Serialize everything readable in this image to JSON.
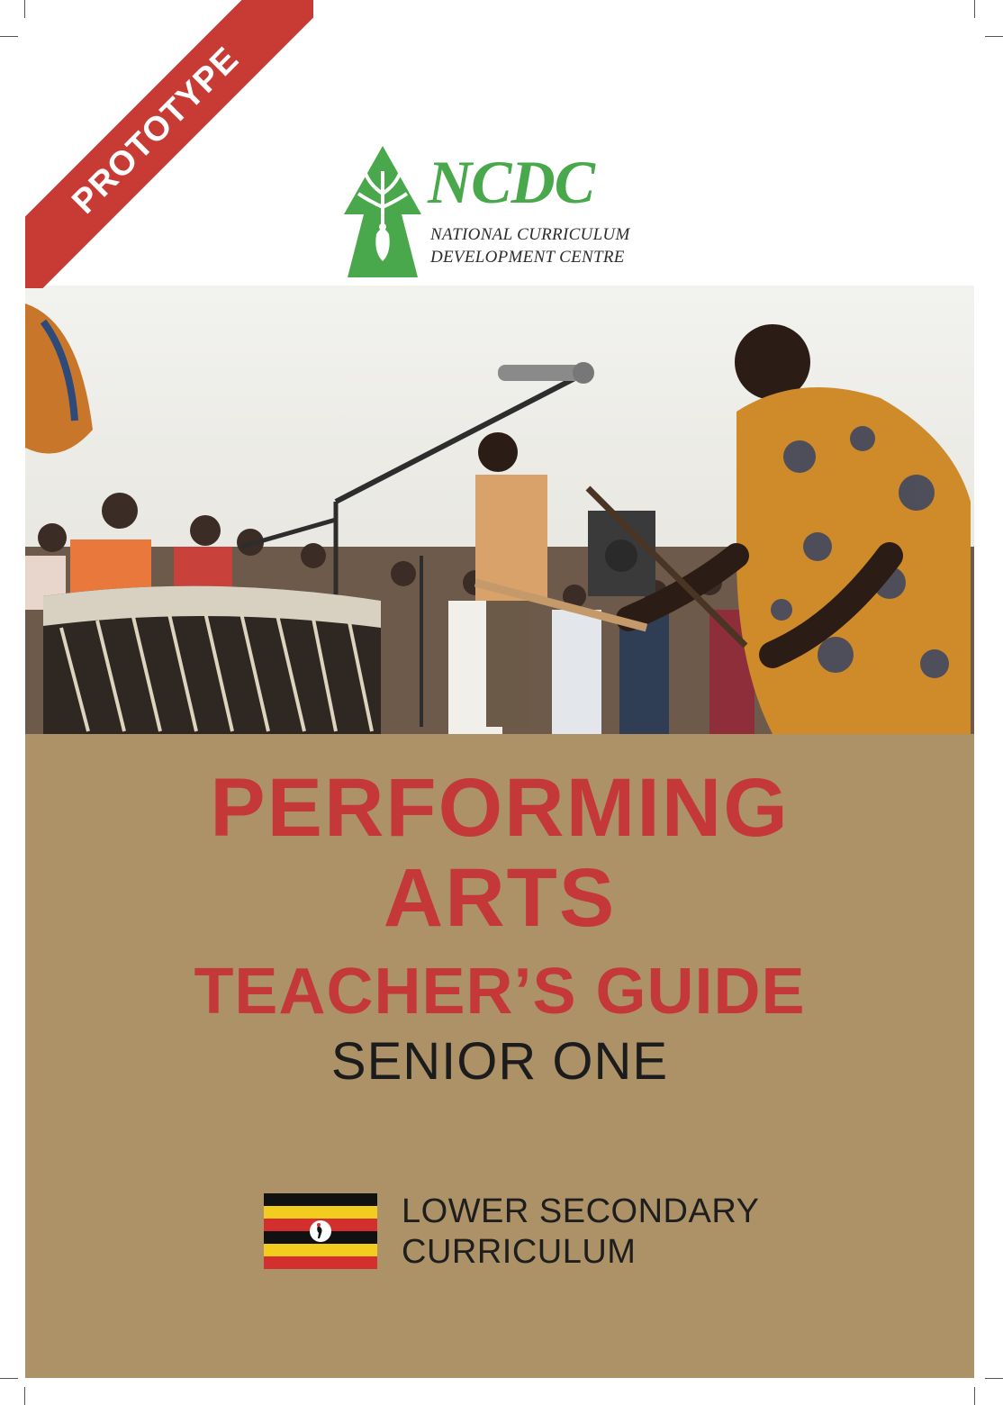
{
  "ribbon": {
    "label": "PROTOTYPE"
  },
  "logo": {
    "abbr": "NCDC",
    "line1": "NATIONAL CURRICULUM",
    "line2": "DEVELOPMENT CENTRE"
  },
  "cover": {
    "title_line1": "PERFORMING",
    "title_line2": "ARTS",
    "guide": "TEACHER’S GUIDE",
    "level": "SENIOR ONE",
    "curriculum_line1": "LOWER SECONDARY",
    "curriculum_line2": "CURRICULUM"
  },
  "colors": {
    "title_red": "#c5383a",
    "ribbon_red": "#c83a34",
    "tan_background": "#ad9268",
    "logo_green": "#4aa84c"
  },
  "icons": [
    "ncdc-crest-icon",
    "uganda-flag-icon"
  ]
}
